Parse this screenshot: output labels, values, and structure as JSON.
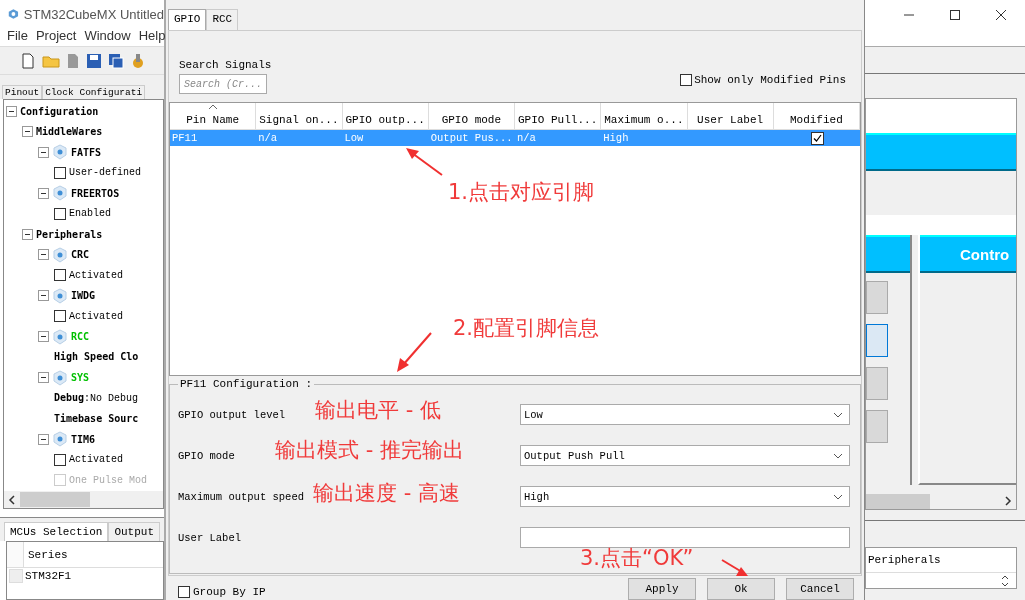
{
  "app": {
    "title": "STM32CubeMX Untitled",
    "menu": [
      "File",
      "Project",
      "Window",
      "Help"
    ],
    "tabs": [
      {
        "label": "Pinout",
        "selected": false
      },
      {
        "label": "Clock Configurati",
        "selected": false
      }
    ],
    "tree": [
      {
        "kind": "group",
        "label": "Configuration",
        "expanded": true,
        "children": [
          {
            "kind": "group",
            "label": "MiddleWares",
            "expanded": true,
            "children": [
              {
                "kind": "module",
                "label": "FATFS",
                "color": "#000000",
                "expanded": true,
                "children": [
                  {
                    "kind": "checkbox",
                    "label": "User-defined",
                    "checked": false,
                    "disabled": false
                  }
                ]
              },
              {
                "kind": "module",
                "label": "FREERTOS",
                "color": "#000000",
                "expanded": true,
                "children": [
                  {
                    "kind": "checkbox",
                    "label": "Enabled",
                    "checked": false,
                    "disabled": false
                  }
                ]
              }
            ]
          },
          {
            "kind": "group",
            "label": "Peripherals",
            "expanded": true,
            "children": [
              {
                "kind": "module",
                "label": "CRC",
                "color": "#000000",
                "expanded": true,
                "children": [
                  {
                    "kind": "checkbox",
                    "label": "Activated",
                    "checked": false,
                    "disabled": false
                  }
                ]
              },
              {
                "kind": "module",
                "label": "IWDG",
                "color": "#000000",
                "expanded": true,
                "children": [
                  {
                    "kind": "checkbox",
                    "label": "Activated",
                    "checked": false,
                    "disabled": false
                  }
                ]
              },
              {
                "kind": "module",
                "label": "RCC",
                "color": "#00c000",
                "expanded": true,
                "children": [
                  {
                    "kind": "text",
                    "label": "**High Speed Clo**"
                  }
                ]
              },
              {
                "kind": "module",
                "label": "SYS",
                "color": "#00c000",
                "expanded": true,
                "children": [
                  {
                    "kind": "text",
                    "label": "**Debug**:No Debug"
                  },
                  {
                    "kind": "text",
                    "label": "**Timebase Sourc**"
                  }
                ]
              },
              {
                "kind": "module",
                "label": "TIM6",
                "color": "#000000",
                "expanded": true,
                "children": [
                  {
                    "kind": "checkbox",
                    "label": "Activated",
                    "checked": false,
                    "disabled": false
                  },
                  {
                    "kind": "checkbox",
                    "label": "One Pulse Mod",
                    "checked": false,
                    "disabled": true
                  }
                ]
              }
            ]
          }
        ]
      }
    ],
    "bottom_tabs": [
      {
        "label": "MCUs Selection",
        "selected": true
      },
      {
        "label": "Output",
        "selected": false
      }
    ],
    "mcu_table": {
      "columns": [
        "Series"
      ],
      "rows": [
        "STM32F1"
      ]
    },
    "right_panel": {
      "header": "Contro",
      "column": "Peripherals"
    }
  },
  "dialog": {
    "tabs": [
      {
        "label": "GPIO",
        "selected": true
      },
      {
        "label": "RCC",
        "selected": false
      }
    ],
    "search": {
      "label": "Search Signals",
      "placeholder": "Search (Cr..."
    },
    "modified_only": {
      "label": "Show only Modified Pins",
      "checked": false
    },
    "table": {
      "columns": [
        "Pin Name",
        "Signal on...",
        "GPIO outp...",
        "GPIO mode",
        "GPIO Pull...",
        "Maximum o...",
        "User Label",
        "Modified"
      ],
      "rows": [
        {
          "cells": [
            "PF11",
            "n/a",
            "Low",
            "Output Pus...",
            "n/a",
            "High",
            null
          ],
          "modified": true,
          "selected": true
        }
      ]
    },
    "config": {
      "title": "PF11 Configuration :",
      "fields": [
        {
          "kind": "select",
          "label": "GPIO output level",
          "value": "Low"
        },
        {
          "kind": "select",
          "label": "GPIO mode",
          "value": "Output Push Pull"
        },
        {
          "kind": "select",
          "label": "Maximum output speed",
          "value": "High"
        },
        {
          "kind": "text",
          "label": "User Label"
        }
      ]
    },
    "group_by_ip": {
      "label": "Group By IP",
      "checked": false
    },
    "buttons": [
      "Apply",
      "Ok",
      "Cancel"
    ]
  },
  "annotations": [
    "1.点击对应引脚",
    "2.配置引脚信息",
    "输出电平 - 低",
    "输出模式 - 推完输出",
    "输出速度 - 高速",
    "3.点击“OK”"
  ]
}
